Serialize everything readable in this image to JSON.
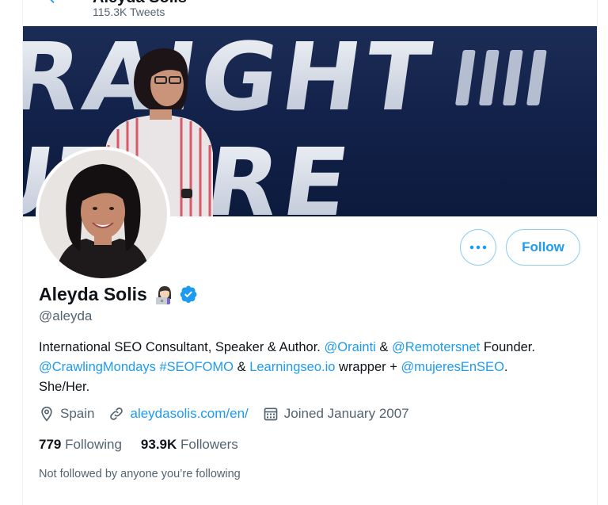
{
  "header": {
    "name": "Aleyda Solis",
    "tweet_count": "115.3K Tweets"
  },
  "profile": {
    "display_name": "Aleyda Solis",
    "handle": "@aleyda",
    "bio": {
      "line1_text1": "International SEO Consultant, Speaker & Author. ",
      "line1_link1": "@Orainti",
      "line1_text2": " & ",
      "line1_link2": "@Remotersnet",
      "line1_text3": " Founder.",
      "line2_link1": "@CrawlingMondays",
      "line2_text1": " ",
      "line2_link2": "#SEOFOMO",
      "line2_text2": " & ",
      "line2_link3": "Learningseo.io",
      "line2_text3": " wrapper + ",
      "line2_link4": "@mujeresEnSEO",
      "line2_text4": ".",
      "line3_text": "She/Her."
    },
    "location": "Spain",
    "website": "aleydasolis.com/en/",
    "joined": "Joined January 2007",
    "following_count": "779",
    "following_label": "Following",
    "followers_count": "93.9K",
    "followers_label": "Followers",
    "mutuals_note": "Not followed by anyone you’re following"
  },
  "buttons": {
    "more_label": "•••",
    "follow_label": "Follow"
  },
  "banner": {
    "text_line1": "RAIGHT",
    "text_line2": "UTURE"
  },
  "icons": {
    "back": "arrow-left-icon",
    "verified": "verified-badge-icon",
    "emoji": "woman-technologist-emoji",
    "location": "location-pin-icon",
    "website": "link-icon",
    "joined": "calendar-icon"
  },
  "colors": {
    "accent": "#1d9bf0",
    "muted": "#536471",
    "text": "#0f1419",
    "follow_border": "#8ecdf8"
  }
}
